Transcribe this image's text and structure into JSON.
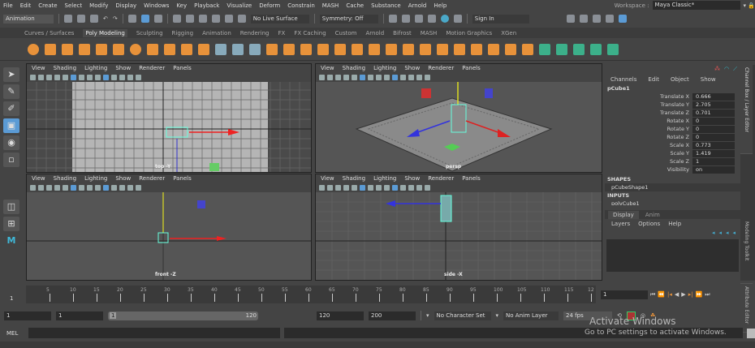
{
  "menubar": {
    "items": [
      "File",
      "Edit",
      "Create",
      "Select",
      "Modify",
      "Display",
      "Windows",
      "Key",
      "Playback",
      "Visualize",
      "Deform",
      "Constrain",
      "MASH",
      "Cache",
      "Substance",
      "Arnold",
      "Help"
    ],
    "workspace_label": "Workspace :",
    "workspace_value": "Maya Classic*"
  },
  "status_line": {
    "mode": "Animation",
    "live_surface": "No Live Surface",
    "symmetry": "Symmetry: Off",
    "sign_in": "Sign In"
  },
  "shelf": {
    "tabs": [
      "Curves / Surfaces",
      "Poly Modeling",
      "Sculpting",
      "Rigging",
      "Animation",
      "Rendering",
      "FX",
      "FX Caching",
      "Custom",
      "Arnold",
      "Bifrost",
      "MASH",
      "Motion Graphics",
      "XGen"
    ],
    "active": "Poly Modeling"
  },
  "viewport_menu": [
    "View",
    "Shading",
    "Lighting",
    "Show",
    "Renderer",
    "Panels"
  ],
  "viewports": [
    {
      "label": "top -Y"
    },
    {
      "label": "persp"
    },
    {
      "label": "front -Z"
    },
    {
      "label": "side -X"
    }
  ],
  "channel_box": {
    "menu": [
      "Channels",
      "Edit",
      "Object",
      "Show"
    ],
    "object": "pCube1",
    "attributes": [
      {
        "name": "Translate X",
        "value": "0.666"
      },
      {
        "name": "Translate Y",
        "value": "2.705"
      },
      {
        "name": "Translate Z",
        "value": "0.701"
      },
      {
        "name": "Rotate X",
        "value": "0"
      },
      {
        "name": "Rotate Y",
        "value": "0"
      },
      {
        "name": "Rotate Z",
        "value": "0"
      },
      {
        "name": "Scale X",
        "value": "0.773"
      },
      {
        "name": "Scale Y",
        "value": "1.419"
      },
      {
        "name": "Scale Z",
        "value": "1"
      },
      {
        "name": "Visibility",
        "value": "on"
      }
    ],
    "shapes_header": "SHAPES",
    "shape": "pCubeShape1",
    "inputs_header": "INPUTS",
    "input": "polyCube1"
  },
  "layer_editor": {
    "tabs": [
      "Display",
      "Anim"
    ],
    "menu": [
      "Layers",
      "Options",
      "Help"
    ]
  },
  "side_tabs": [
    "Channel Box / Layer Editor",
    "Modeling Toolkit",
    "Attribute Editor"
  ],
  "timeline": {
    "ticks": [
      "5",
      "10",
      "15",
      "20",
      "25",
      "30",
      "35",
      "40",
      "45",
      "50",
      "55",
      "60",
      "65",
      "70",
      "75",
      "80",
      "85",
      "90",
      "95",
      "100",
      "105",
      "110",
      "115",
      "12"
    ],
    "current_frame": "1",
    "frame_field": "1"
  },
  "range": {
    "start": "1",
    "anim_start": "1",
    "slider_start": "1",
    "slider_end": "120",
    "end": "120",
    "anim_end": "200",
    "character_set": "No Character Set",
    "anim_layer": "No Anim Layer",
    "fps": "24 fps"
  },
  "command_line": {
    "label": "MEL"
  },
  "watermark": {
    "title": "Activate Windows",
    "subtitle": "Go to PC settings to activate Windows."
  }
}
